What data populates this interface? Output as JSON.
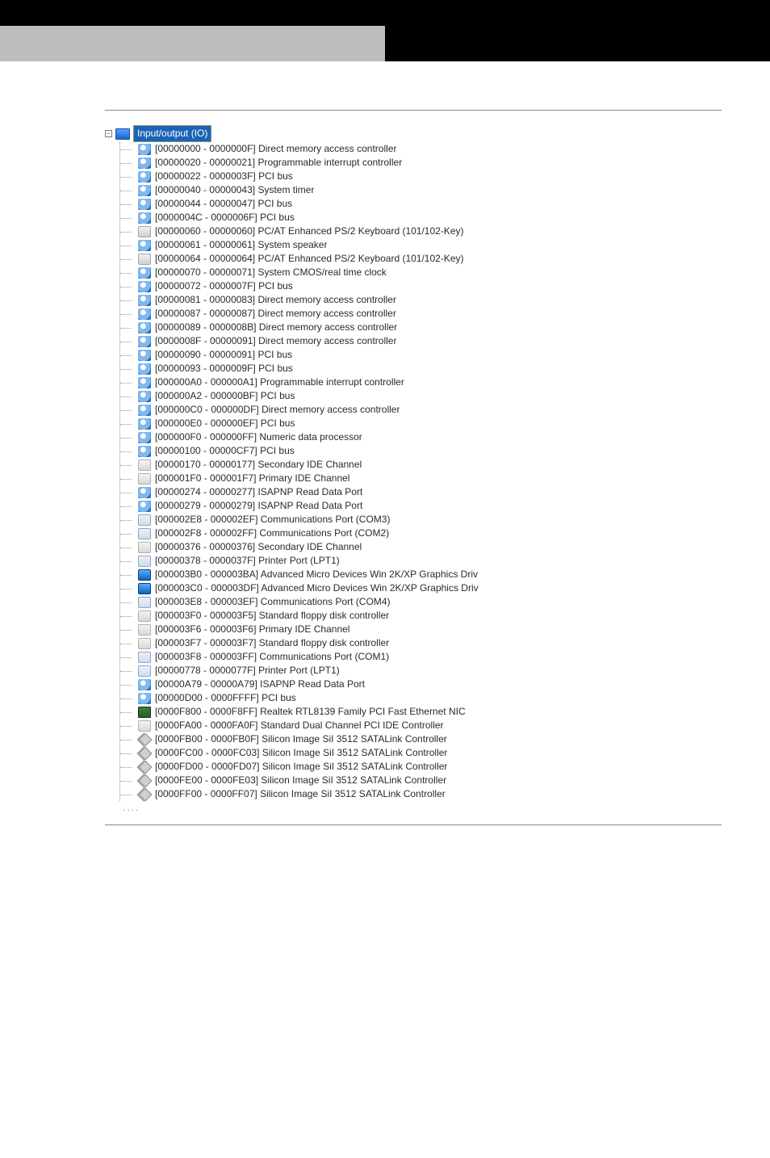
{
  "tree": {
    "root_label": "Input/output (IO)",
    "items": [
      {
        "icon": "generic",
        "range": "[00000000 - 0000000F]",
        "name": "Direct memory access controller"
      },
      {
        "icon": "generic",
        "range": "[00000020 - 00000021]",
        "name": "Programmable interrupt controller"
      },
      {
        "icon": "generic",
        "range": "[00000022 - 0000003F]",
        "name": "PCI bus"
      },
      {
        "icon": "generic",
        "range": "[00000040 - 00000043]",
        "name": "System timer"
      },
      {
        "icon": "generic",
        "range": "[00000044 - 00000047]",
        "name": "PCI bus"
      },
      {
        "icon": "generic",
        "range": "[0000004C - 0000006F]",
        "name": "PCI bus"
      },
      {
        "icon": "kbd",
        "range": "[00000060 - 00000060]",
        "name": "PC/AT Enhanced PS/2 Keyboard (101/102-Key)"
      },
      {
        "icon": "generic",
        "range": "[00000061 - 00000061]",
        "name": "System speaker"
      },
      {
        "icon": "kbd",
        "range": "[00000064 - 00000064]",
        "name": "PC/AT Enhanced PS/2 Keyboard (101/102-Key)"
      },
      {
        "icon": "generic",
        "range": "[00000070 - 00000071]",
        "name": "System CMOS/real time clock"
      },
      {
        "icon": "generic",
        "range": "[00000072 - 0000007F]",
        "name": "PCI bus"
      },
      {
        "icon": "generic",
        "range": "[00000081 - 00000083]",
        "name": "Direct memory access controller"
      },
      {
        "icon": "generic",
        "range": "[00000087 - 00000087]",
        "name": "Direct memory access controller"
      },
      {
        "icon": "generic",
        "range": "[00000089 - 0000008B]",
        "name": "Direct memory access controller"
      },
      {
        "icon": "generic",
        "range": "[0000008F - 00000091]",
        "name": "Direct memory access controller"
      },
      {
        "icon": "generic",
        "range": "[00000090 - 00000091]",
        "name": "PCI bus"
      },
      {
        "icon": "generic",
        "range": "[00000093 - 0000009F]",
        "name": "PCI bus"
      },
      {
        "icon": "generic",
        "range": "[000000A0 - 000000A1]",
        "name": "Programmable interrupt controller"
      },
      {
        "icon": "generic",
        "range": "[000000A2 - 000000BF]",
        "name": "PCI bus"
      },
      {
        "icon": "generic",
        "range": "[000000C0 - 000000DF]",
        "name": "Direct memory access controller"
      },
      {
        "icon": "generic",
        "range": "[000000E0 - 000000EF]",
        "name": "PCI bus"
      },
      {
        "icon": "generic",
        "range": "[000000F0 - 000000FF]",
        "name": "Numeric data processor"
      },
      {
        "icon": "generic",
        "range": "[00000100 - 00000CF7]",
        "name": "PCI bus"
      },
      {
        "icon": "ide",
        "range": "[00000170 - 00000177]",
        "name": "Secondary IDE Channel"
      },
      {
        "icon": "ide",
        "range": "[000001F0 - 000001F7]",
        "name": "Primary IDE Channel"
      },
      {
        "icon": "generic",
        "range": "[00000274 - 00000277]",
        "name": "ISAPNP Read Data Port"
      },
      {
        "icon": "generic",
        "range": "[00000279 - 00000279]",
        "name": "ISAPNP Read Data Port"
      },
      {
        "icon": "port",
        "range": "[000002E8 - 000002EF]",
        "name": "Communications Port (COM3)"
      },
      {
        "icon": "port",
        "range": "[000002F8 - 000002FF]",
        "name": "Communications Port (COM2)"
      },
      {
        "icon": "ide",
        "range": "[00000376 - 00000376]",
        "name": "Secondary IDE Channel"
      },
      {
        "icon": "port",
        "range": "[00000378 - 0000037F]",
        "name": "Printer Port (LPT1)"
      },
      {
        "icon": "display",
        "range": "[000003B0 - 000003BA]",
        "name": "Advanced Micro Devices Win 2K/XP Graphics Driv"
      },
      {
        "icon": "display",
        "range": "[000003C0 - 000003DF]",
        "name": "Advanced Micro Devices Win 2K/XP Graphics Driv"
      },
      {
        "icon": "port",
        "range": "[000003E8 - 000003EF]",
        "name": "Communications Port (COM4)"
      },
      {
        "icon": "ide",
        "range": "[000003F0 - 000003F5]",
        "name": "Standard floppy disk controller"
      },
      {
        "icon": "ide",
        "range": "[000003F6 - 000003F6]",
        "name": "Primary IDE Channel"
      },
      {
        "icon": "ide",
        "range": "[000003F7 - 000003F7]",
        "name": "Standard floppy disk controller"
      },
      {
        "icon": "port",
        "range": "[000003F8 - 000003FF]",
        "name": "Communications Port (COM1)"
      },
      {
        "icon": "port",
        "range": "[00000778 - 0000077F]",
        "name": "Printer Port (LPT1)"
      },
      {
        "icon": "generic",
        "range": "[00000A79 - 00000A79]",
        "name": "ISAPNP Read Data Port"
      },
      {
        "icon": "generic",
        "range": "[00000D00 - 0000FFFF]",
        "name": "PCI bus"
      },
      {
        "icon": "nic",
        "range": "[0000F800 - 0000F8FF]",
        "name": "Realtek RTL8139 Family PCI Fast Ethernet NIC"
      },
      {
        "icon": "ide",
        "range": "[0000FA00 - 0000FA0F]",
        "name": "Standard Dual Channel PCI IDE Controller"
      },
      {
        "icon": "scsi",
        "range": "[0000FB00 - 0000FB0F]",
        "name": "Silicon Image SiI 3512 SATALink Controller"
      },
      {
        "icon": "scsi",
        "range": "[0000FC00 - 0000FC03]",
        "name": "Silicon Image SiI 3512 SATALink Controller"
      },
      {
        "icon": "scsi",
        "range": "[0000FD00 - 0000FD07]",
        "name": "Silicon Image SiI 3512 SATALink Controller"
      },
      {
        "icon": "scsi",
        "range": "[0000FE00 - 0000FE03]",
        "name": "Silicon Image SiI 3512 SATALink Controller"
      },
      {
        "icon": "scsi",
        "range": "[0000FF00 - 0000FF07]",
        "name": "Silicon Image SiI 3512 SATALink Controller"
      }
    ]
  },
  "icons": {
    "generic": "device-generic-icon",
    "kbd": "keyboard-icon",
    "ide": "storage-controller-icon",
    "port": "serial-port-icon",
    "display": "display-adapter-icon",
    "nic": "network-adapter-icon",
    "scsi": "scsi-controller-icon"
  }
}
